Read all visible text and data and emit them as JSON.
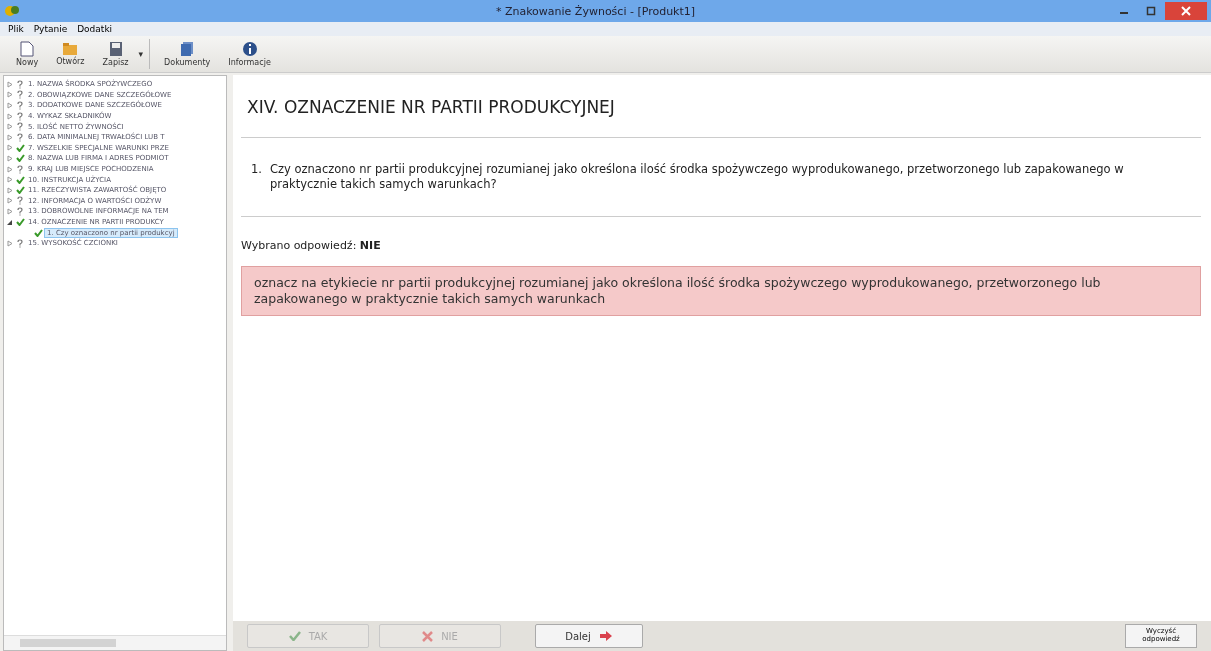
{
  "window": {
    "title": "* Znakowanie Żywności - [Produkt1]"
  },
  "menu": [
    "Plik",
    "Pytanie",
    "Dodatki"
  ],
  "toolbar": [
    {
      "label": "Nowy"
    },
    {
      "label": "Otwórz"
    },
    {
      "label": "Zapisz",
      "dropdown": "▾"
    },
    {
      "label": "Dokumenty"
    },
    {
      "label": "Informacje"
    }
  ],
  "tree": [
    {
      "label": "1. NAZWA ŚRODKA SPOŻYWCZEGO",
      "answered": false,
      "expanded": false,
      "selected": false
    },
    {
      "label": "2. OBOWIĄZKOWE DANE SZCZEGÓŁOWE",
      "answered": false,
      "expanded": false,
      "selected": false
    },
    {
      "label": "3. DODATKOWE DANE SZCZEGÓŁOWE",
      "answered": false,
      "expanded": false,
      "selected": false
    },
    {
      "label": "4. WYKAZ SKŁADNIKÓW",
      "answered": false,
      "expanded": false,
      "selected": false
    },
    {
      "label": "5. ILOŚĆ NETTO ŻYWNOŚCI",
      "answered": false,
      "expanded": false,
      "selected": false
    },
    {
      "label": "6. DATA MINIMALNEJ TRWAŁOŚCI LUB T",
      "answered": false,
      "expanded": false,
      "selected": false
    },
    {
      "label": "7. WSZELKIE SPECJALNE WARUNKI PRZE",
      "answered": true,
      "expanded": false,
      "selected": false
    },
    {
      "label": "8. NAZWA LUB FIRMA I ADRES PODMIOT",
      "answered": true,
      "expanded": false,
      "selected": false
    },
    {
      "label": "9. KRAJ LUB MIEJSCE POCHODZENIA",
      "answered": false,
      "expanded": false,
      "selected": false
    },
    {
      "label": "10. INSTRUKCJA UŻYCIA",
      "answered": true,
      "expanded": false,
      "selected": false
    },
    {
      "label": "11. RZECZYWISTA ZAWARTOŚĆ OBJĘTO",
      "answered": true,
      "expanded": false,
      "selected": false
    },
    {
      "label": "12. INFORMACJA O WARTOŚCI ODŻYW",
      "answered": false,
      "expanded": false,
      "selected": false
    },
    {
      "label": "13. DOBROWOLNE INFORMACJE NA TEM",
      "answered": false,
      "expanded": false,
      "selected": false
    },
    {
      "label": "14. OZNACZENIE NR PARTII PRODUKCY",
      "answered": true,
      "expanded": true,
      "selected": false,
      "children": [
        {
          "label": "1. Czy oznaczono nr partii produkcyj",
          "answered": true,
          "selected": true
        }
      ]
    },
    {
      "label": "15. WYSOKOŚĆ CZCIONKI",
      "answered": false,
      "expanded": false,
      "selected": false
    }
  ],
  "section_title": "XIV. OZNACZENIE NR PARTII PRODUKCYJNEJ",
  "question": {
    "number": "1.",
    "text": "Czy oznaczono nr partii produkcyjnej rozumianej jako określona ilość środka spożywczego wyprodukowanego, przetworzonego lub zapakowanego w praktycznie takich samych warunkach?"
  },
  "answer": "Wybrano odpowiedź: **NIE**",
  "recommendation": "oznacz na etykiecie nr partii produkcyjnej rozumianej jako określona ilość środka spożywczego wyprodukowanego, przetworzonego lub zapakowanego w praktycznie takich samych warunkach",
  "buttons": [
    {
      "label": "TAK",
      "kind": "yes",
      "disabled": true
    },
    {
      "label": "NIE",
      "kind": "no",
      "disabled": true
    },
    {
      "label": "Dalej",
      "kind": "next",
      "disabled": false
    }
  ],
  "clear_button": "Wyczyść odpowiedź"
}
